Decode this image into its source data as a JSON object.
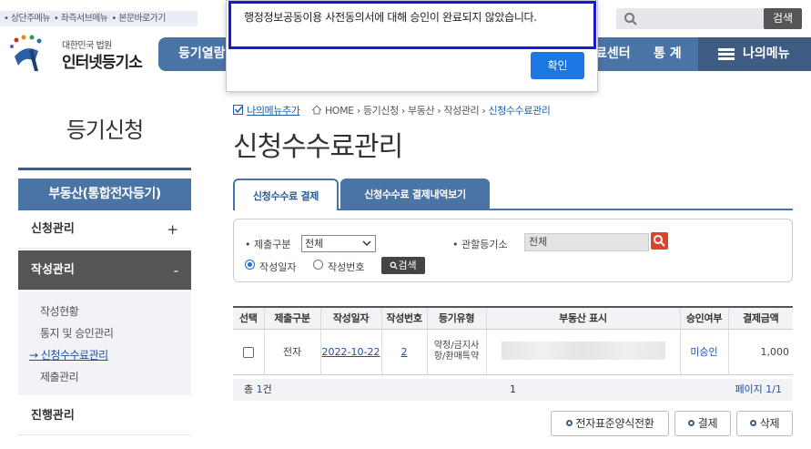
{
  "skip_links": [
    "• 상단주메뉴",
    "• 좌측서브메뉴",
    "• 본문바로가기"
  ],
  "logo": {
    "line1": "대한민국 법원",
    "line2": "인터넷등기소"
  },
  "nav": {
    "items": [
      "등기열람",
      "료센터",
      "통 계"
    ],
    "my_menu": "나의메뉴"
  },
  "search": {
    "placeholder": "",
    "button": "검색"
  },
  "dialog": {
    "message": "행정정보공동이용 사전동의서에 대해 승인이 완료되지 않았습니다.",
    "ok": "확인"
  },
  "sidebar": {
    "title": "등기신청",
    "main": "부동산(통합전자등기)",
    "section1": {
      "label": "신청관리",
      "sign": "+"
    },
    "section2": {
      "label": "작성관리",
      "sign": "-"
    },
    "sub_items": [
      "작성현황",
      "통지 및 승인관리",
      "→ 신청수수료관리",
      "제출관리"
    ],
    "section3": {
      "label": "진행관리"
    }
  },
  "breadcrumb": {
    "favorite": "나의메뉴추가",
    "home": "HOME",
    "path": [
      "등기신청",
      "부동산",
      "작성관리",
      "신청수수료관리"
    ]
  },
  "page_title": "신청수수료관리",
  "tabs": [
    "신청수수료 결제",
    "신청수수료 결제내역보기"
  ],
  "filter": {
    "submit_type_label": "• 제출구분",
    "submit_type_value": "전체",
    "court_label": "• 관할등기소",
    "court_value": "전체",
    "radio1": "작성일자",
    "radio2": "작성번호",
    "search_button": "검색"
  },
  "table": {
    "headers": [
      "선택",
      "제출구분",
      "작성일자",
      "작성번호",
      "등기유형",
      "부동산 표시",
      "승인여부",
      "결제금액"
    ],
    "rows": [
      {
        "type": "전자",
        "date": "2022-10-22",
        "number": "2",
        "reg_type": "약정/금지사항/환매특약",
        "approval": "미승인",
        "amount": "1,000"
      }
    ]
  },
  "footer": {
    "total_prefix": "총 ",
    "total_count": "1",
    "total_suffix": "건",
    "page": "1",
    "pages": "페이지 1/1"
  },
  "buttons": [
    "전자표준양식전환",
    "결제",
    "삭제"
  ]
}
